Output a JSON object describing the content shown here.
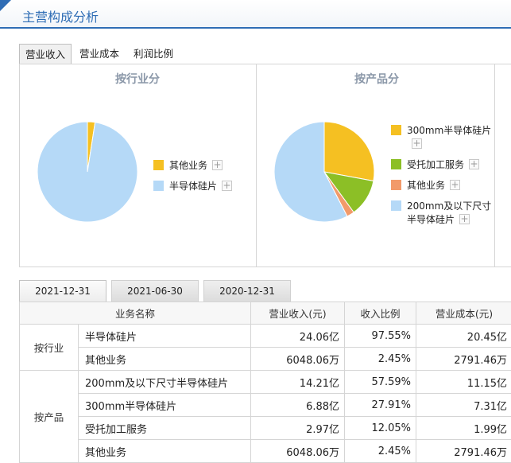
{
  "header": {
    "title": "主营构成分析"
  },
  "top_tabs": [
    {
      "label": "营业收入",
      "active": true
    },
    {
      "label": "营业成本",
      "active": false
    },
    {
      "label": "利润比例",
      "active": false
    }
  ],
  "panels": {
    "industry": {
      "title": "按行业分",
      "legend": [
        {
          "label": "其他业务",
          "color": "#f5c022"
        },
        {
          "label": "半导体硅片",
          "color": "#b5d9f7"
        }
      ]
    },
    "product": {
      "title": "按产品分",
      "legend": [
        {
          "label": "300mm半导体硅片",
          "color": "#f5c022"
        },
        {
          "label": "受托加工服务",
          "color": "#8cbf26"
        },
        {
          "label": "其他业务",
          "color": "#f29a6a"
        },
        {
          "label_line1": "200mm及以下尺寸",
          "label_line2": "半导体硅片",
          "color": "#b5d9f7"
        }
      ]
    }
  },
  "chart_data": [
    {
      "type": "pie",
      "title": "按行业分",
      "labels": [
        "其他业务",
        "半导体硅片"
      ],
      "values": [
        2.45,
        97.55
      ],
      "colors": [
        "#f5c022",
        "#b5d9f7"
      ]
    },
    {
      "type": "pie",
      "title": "按产品分",
      "labels": [
        "300mm半导体硅片",
        "受托加工服务",
        "其他业务",
        "200mm及以下尺寸半导体硅片"
      ],
      "values": [
        27.91,
        12.05,
        2.45,
        57.59
      ],
      "colors": [
        "#f5c022",
        "#8cbf26",
        "#f29a6a",
        "#b5d9f7"
      ]
    }
  ],
  "date_tabs": [
    {
      "label": "2021-12-31",
      "active": true
    },
    {
      "label": "2021-06-30",
      "active": false
    },
    {
      "label": "2020-12-31",
      "active": false
    }
  ],
  "table": {
    "headers": [
      "业务名称",
      "营业收入(元)",
      "收入比例",
      "营业成本(元)"
    ],
    "groups": [
      {
        "label": "按行业",
        "rows": [
          [
            "半导体硅片",
            "24.06亿",
            "97.55%",
            "20.45亿"
          ],
          [
            "其他业务",
            "6048.06万",
            "2.45%",
            "2791.46万"
          ]
        ]
      },
      {
        "label": "按产品",
        "rows": [
          [
            "200mm及以下尺寸半导体硅片",
            "14.21亿",
            "57.59%",
            "11.15亿"
          ],
          [
            "300mm半导体硅片",
            "6.88亿",
            "27.91%",
            "7.31亿"
          ],
          [
            "受托加工服务",
            "2.97亿",
            "12.05%",
            "1.99亿"
          ],
          [
            "其他业务",
            "6048.06万",
            "2.45%",
            "2791.46万"
          ]
        ]
      }
    ]
  }
}
